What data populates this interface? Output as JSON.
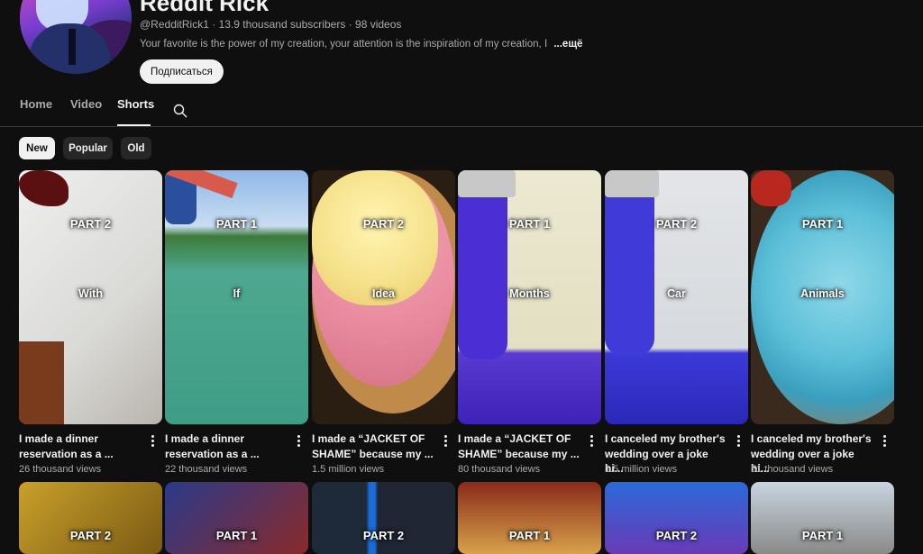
{
  "channel": {
    "name": "Reddit Rick",
    "handle": "@RedditRick1",
    "subscribers": "13.9 thousand subscribers",
    "videos": "98 videos",
    "separator": "·",
    "description": "Your favorite is the power of my creation, your attention is the inspiration of my creation, I",
    "more_label": "...ещё",
    "subscribe_label": "Подписаться"
  },
  "tabs": [
    {
      "label": "Home"
    },
    {
      "label": "Video"
    },
    {
      "label": "Shorts",
      "active": true
    }
  ],
  "search_icon": "search-icon",
  "chips": [
    {
      "label": "New",
      "active": true
    },
    {
      "label": "Popular"
    },
    {
      "label": "Old"
    }
  ],
  "shorts": [
    {
      "part": "PART 2",
      "word": "With",
      "title_line1": "I made a dinner",
      "title_line2": "reservation as a ...",
      "views": "26 thousand views"
    },
    {
      "part": "PART 1",
      "word": "If",
      "title_line1": "I made a dinner",
      "title_line2": "reservation as a ...",
      "views": "22 thousand views"
    },
    {
      "part": "PART 2",
      "word": "Idea",
      "title_line1": "I made a “JACKET OF",
      "title_line2": "SHAME” because my ...",
      "views": "1.5 million views"
    },
    {
      "part": "PART 1",
      "word": "Months",
      "title_line1": "I made a “JACKET OF",
      "title_line2": "SHAME” because my ...",
      "views": "80 thousand views"
    },
    {
      "part": "PART 2",
      "word": "Car",
      "title_line1": "I canceled my brother's",
      "title_line2": "wedding over a joke hi...",
      "views": "1.5 million views"
    },
    {
      "part": "PART 1",
      "word": "Animals",
      "title_line1": "I canceled my brother's",
      "title_line2": "wedding over a joke hi...",
      "views": "51 thousand views"
    }
  ],
  "shorts_row2": [
    {
      "part": "PART 2"
    },
    {
      "part": "PART 1"
    },
    {
      "part": "PART 2"
    },
    {
      "part": "PART 1"
    },
    {
      "part": "PART 2"
    },
    {
      "part": "PART 1"
    }
  ]
}
